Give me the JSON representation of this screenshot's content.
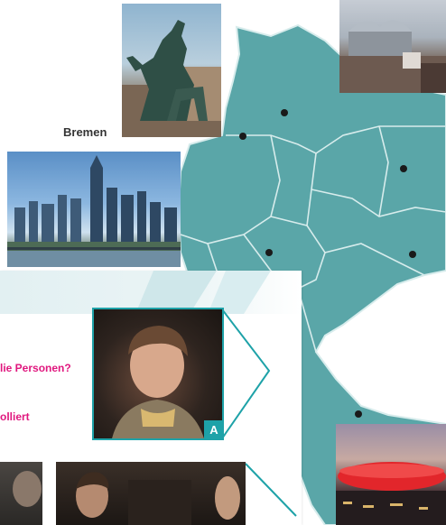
{
  "labels": {
    "bremen": "Bremen"
  },
  "exercise": {
    "question_line1": "lie Personen?",
    "question_line2": "olliert",
    "badge": "A"
  },
  "colors": {
    "map_fill": "#5aa6a8",
    "map_border": "#d7ecec",
    "accent_pink": "#e0177e",
    "accent_teal": "#1ea2a8"
  }
}
